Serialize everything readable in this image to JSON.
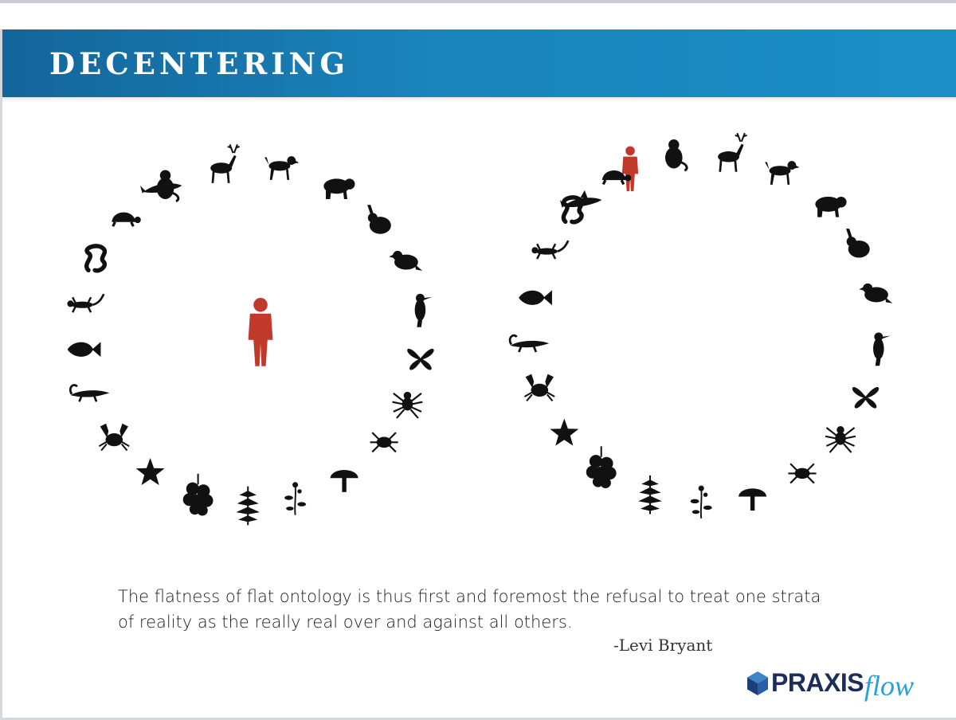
{
  "slide": {
    "title": "DECENTERING",
    "quote_line_1": "The flatness of flat ontology is thus first and foremost the refusal to treat one strata",
    "quote_line_2": "of reality as the really real over and against all others.",
    "attribution": "-Levi Bryant"
  },
  "logo": {
    "brand": "PRAXIS",
    "suffix": "flow"
  },
  "diagrams": [
    {
      "human_position": "center",
      "beings": [
        "deer",
        "dog",
        "bear",
        "rabbit",
        "bird",
        "woodpecker",
        "butterfly",
        "spider",
        "tick",
        "mushroom",
        "flower",
        "fern",
        "moss",
        "starfish",
        "crab",
        "alligator",
        "fish",
        "lizard",
        "snake",
        "turtle",
        "dolphin",
        "monkey"
      ]
    },
    {
      "human_position": "in circle",
      "beings": [
        "human",
        "monkey",
        "deer",
        "dog",
        "bear",
        "rabbit",
        "bird",
        "woodpecker",
        "butterfly",
        "spider",
        "tick",
        "mushroom",
        "flower",
        "fern",
        "moss",
        "starfish",
        "crab",
        "alligator",
        "fish",
        "lizard",
        "snake",
        "turtle",
        "dolphin"
      ]
    }
  ],
  "colors": {
    "banner": "#1a84bb",
    "human": "#c0392b",
    "silhouette": "#111111",
    "brand_dark": "#1c2d5a",
    "brand_light": "#2aa0d8"
  }
}
